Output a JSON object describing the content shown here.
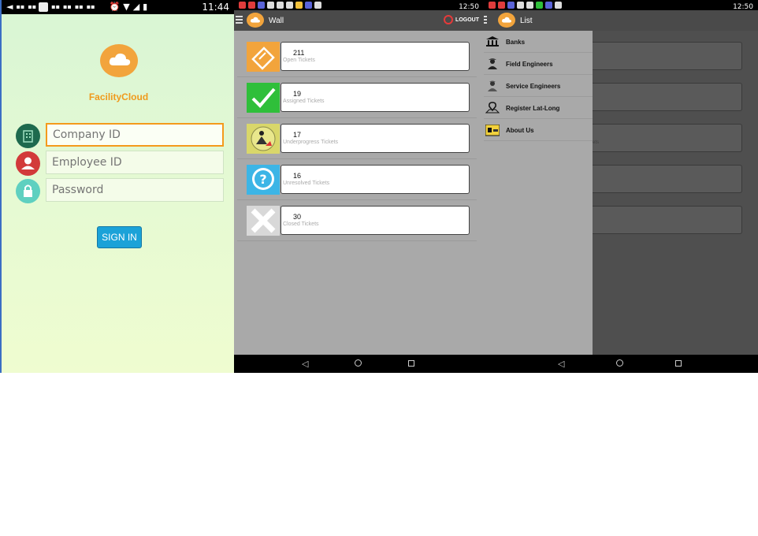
{
  "screen_login": {
    "status_time": "11:44",
    "brand": "FacilityCloud",
    "fields": [
      {
        "placeholder": "Company ID",
        "icon": "building-icon",
        "color": "#1e6a4e"
      },
      {
        "placeholder": "Employee ID",
        "icon": "user-icon",
        "color": "#d23a3a"
      },
      {
        "placeholder": "Password",
        "icon": "lock-icon",
        "color": "#5fd0c0"
      }
    ],
    "signin_label": "SIGN IN"
  },
  "screen_wall": {
    "status_time": "12:50",
    "title": "Wall",
    "logout_label": "LOGOUT",
    "tiles": [
      {
        "count": "211",
        "label": "Open Tickets",
        "icon": "ticket-icon",
        "color": "#f2a43c"
      },
      {
        "count": "19",
        "label": "Assigned Tickets",
        "icon": "check-icon",
        "color": "#2fbf3a"
      },
      {
        "count": "17",
        "label": "Underprogress Tickets",
        "icon": "worker-icon",
        "color": "#d9d76a"
      },
      {
        "count": "16",
        "label": "Unresolved Tickets",
        "icon": "question-icon",
        "color": "#3cb5e6"
      },
      {
        "count": "30",
        "label": "Closed Tickets",
        "icon": "close-icon",
        "color": "#d8d8d8"
      }
    ]
  },
  "screen_list": {
    "status_time": "12:50",
    "title": "List",
    "drawer_items": [
      {
        "label": "Banks",
        "icon": "bank-icon"
      },
      {
        "label": "Field Engineers",
        "icon": "engineer-icon"
      },
      {
        "label": "Service Engineers",
        "icon": "service-engineer-icon"
      },
      {
        "label": "Register Lat-Long",
        "icon": "map-pin-icon"
      },
      {
        "label": "About Us",
        "icon": "about-icon"
      }
    ],
    "ghost_texts": [
      "kets",
      "s"
    ]
  }
}
